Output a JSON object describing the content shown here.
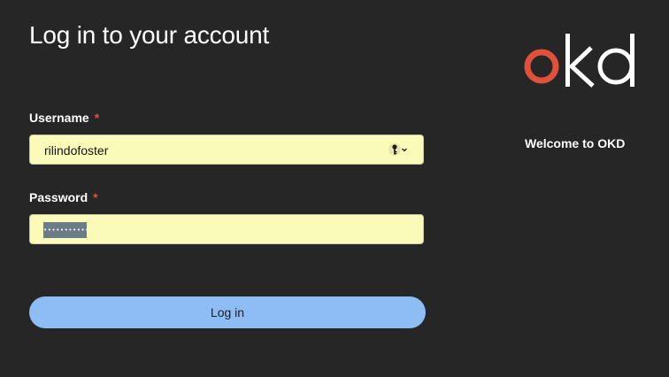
{
  "page": {
    "title": "Log in to your account"
  },
  "form": {
    "username": {
      "label": "Username",
      "required_mark": "*",
      "value": "rilindofoster"
    },
    "password": {
      "label": "Password",
      "required_mark": "*",
      "masked_value": "•••••••••••"
    },
    "login_button_label": "Log in"
  },
  "sidebar": {
    "logo_text": "okd",
    "welcome_text": "Welcome to OKD"
  },
  "icons": {
    "password_manager": "key-icon",
    "dropdown": "chevron-down-icon"
  },
  "colors": {
    "background": "#262626",
    "input_autofill": "#fafab9",
    "button": "#8ebcf5",
    "required": "#e0513c",
    "logo_accent": "#e0513c"
  }
}
